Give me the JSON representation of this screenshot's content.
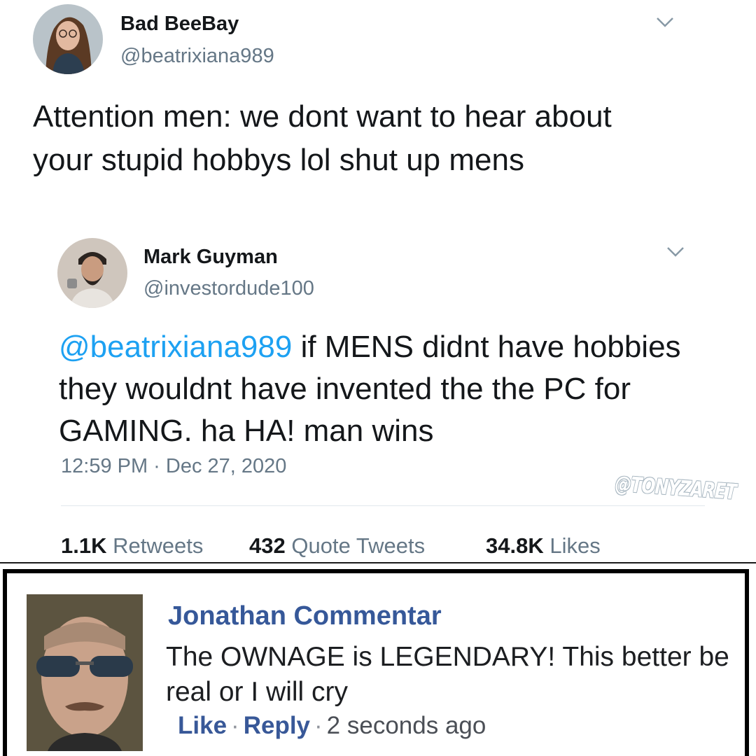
{
  "tweet1": {
    "display_name": "Bad BeeBay",
    "handle": "@beatrixiana989",
    "text": "Attention men: we dont want to hear about your stupid hobbys lol shut up mens",
    "menu_icon": "chevron-down-icon",
    "avatar": "avatar"
  },
  "tweet2": {
    "display_name": "Mark Guyman",
    "handle": "@investordude100",
    "mention": "@beatrixiana989",
    "text": " if MENS didnt have hobbies they wouldnt have invented the the PC for GAMING. ha HA! man wins",
    "timestamp": "12:59 PM · Dec 27, 2020",
    "menu_icon": "chevron-down-icon",
    "avatar": "avatar",
    "stats": {
      "retweets_count": "1.1K",
      "retweets_label": "Retweets",
      "quotes_count": "432",
      "quotes_label": "Quote Tweets",
      "likes_count": "34.8K",
      "likes_label": "Likes"
    }
  },
  "watermark": "@TONYZARET",
  "comment": {
    "author": "Jonathan Commentar",
    "text": "The OWNAGE is LEGENDARY! This better be real or I will cry",
    "like_label": "Like",
    "reply_label": "Reply",
    "separator": "·",
    "time": "2 seconds ago"
  },
  "colors": {
    "twitter_blue": "#1da1f2",
    "twitter_gray": "#657786",
    "facebook_blue": "#365899"
  }
}
